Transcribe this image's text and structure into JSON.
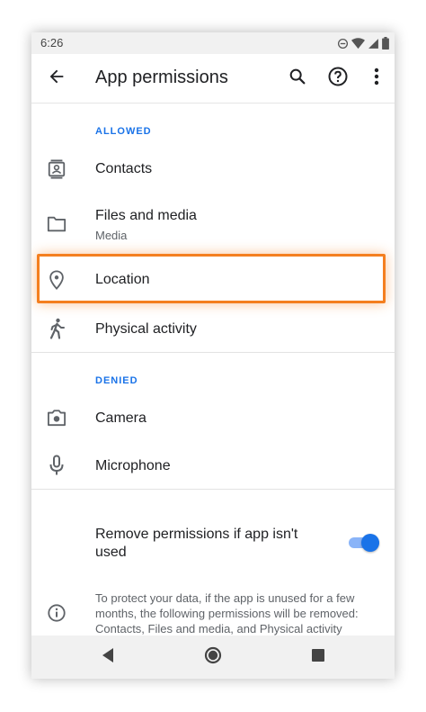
{
  "status_bar": {
    "time": "6:26",
    "icons": [
      "do-not-disturb-icon",
      "wifi-icon",
      "signal-icon",
      "battery-icon"
    ]
  },
  "app_bar": {
    "title": "App permissions",
    "icons": [
      "back-arrow-icon",
      "search-icon",
      "help-icon",
      "more-vert-icon"
    ]
  },
  "allowed": {
    "header": "ALLOWED",
    "items": [
      {
        "label": "Contacts",
        "icon": "contacts-icon"
      },
      {
        "label": "Files and media",
        "sublabel": "Media",
        "icon": "folder-icon"
      },
      {
        "label": "Location",
        "icon": "location-pin-icon"
      },
      {
        "label": "Physical activity",
        "icon": "walking-icon"
      }
    ]
  },
  "denied": {
    "header": "DENIED",
    "items": [
      {
        "label": "Camera",
        "icon": "camera-icon"
      },
      {
        "label": "Microphone",
        "icon": "microphone-icon"
      }
    ]
  },
  "auto_revoke": {
    "label": "Remove permissions if app isn't used",
    "enabled": true,
    "info_text": "To protect your data, if the app is unused for a few months, the following permissions will be removed: Contacts, Files and media, and Physical activity",
    "info_icon": "info-icon"
  },
  "nav_bar": {
    "icons": [
      "nav-back-icon",
      "nav-home-icon",
      "nav-recents-icon"
    ]
  },
  "colors": {
    "accent": "#1a73e8",
    "highlight": "#f47f20",
    "text_primary": "#202124",
    "text_secondary": "#5f6368"
  }
}
